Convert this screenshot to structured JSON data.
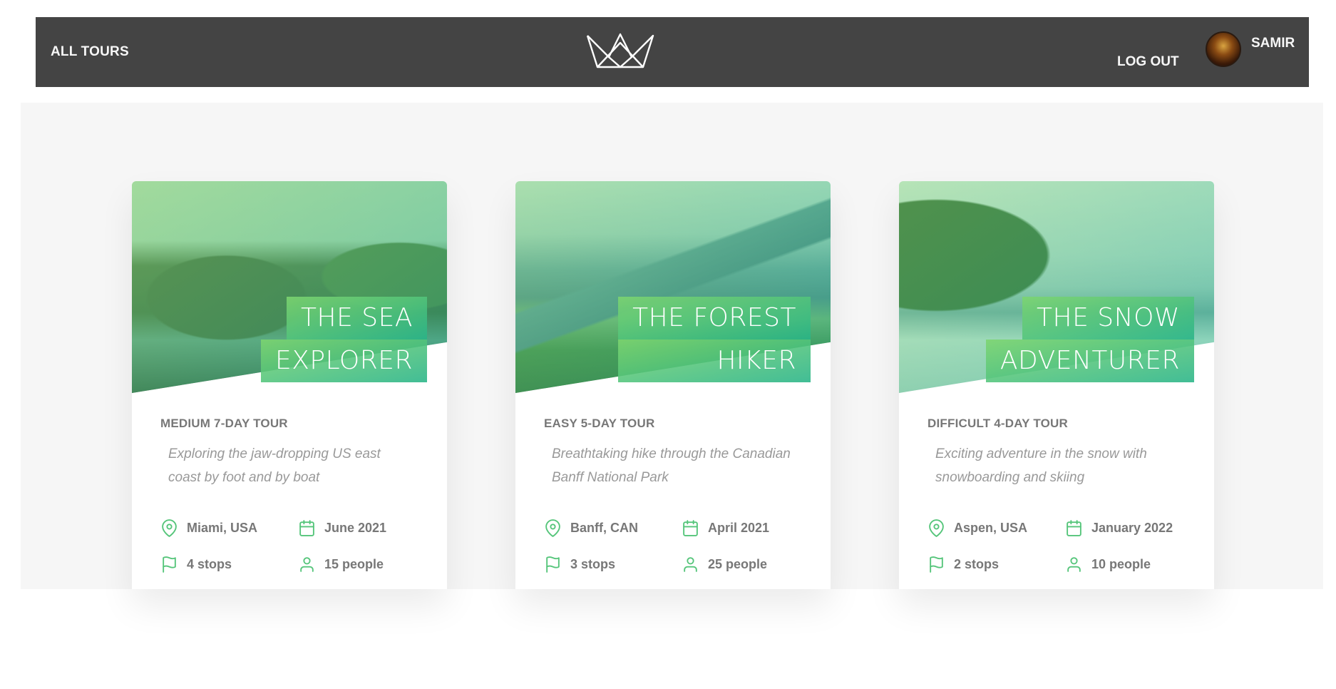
{
  "header": {
    "nav_all_tours": "ALL TOURS",
    "nav_logout": "LOG OUT",
    "user_name": "SAMIR",
    "logo_icon": "crown-logo-icon"
  },
  "colors": {
    "header_bg": "#444444",
    "accent_green": "#55c57a",
    "accent_green_light": "#7dd56f",
    "accent_green_dark": "#28b487",
    "page_bg": "#f6f6f6"
  },
  "tours": [
    {
      "title_line1": "THE SEA",
      "title_line2": "EXPLORER",
      "subheading": "MEDIUM 7-DAY TOUR",
      "summary": "Exploring the jaw-dropping US east coast by foot and by boat",
      "location": "Miami, USA",
      "date": "June 2021",
      "stops": "4 stops",
      "people": "15 people"
    },
    {
      "title_line1": "THE FOREST",
      "title_line2": "HIKER",
      "subheading": "EASY 5-DAY TOUR",
      "summary": "Breathtaking hike through the Canadian Banff National Park",
      "location": "Banff, CAN",
      "date": "April 2021",
      "stops": "3 stops",
      "people": "25 people"
    },
    {
      "title_line1": "THE SNOW",
      "title_line2": "ADVENTURER",
      "subheading": "DIFFICULT 4-DAY TOUR",
      "summary": "Exciting adventure in the snow with snowboarding and skiing",
      "location": "Aspen, USA",
      "date": "January 2022",
      "stops": "2 stops",
      "people": "10 people"
    }
  ]
}
